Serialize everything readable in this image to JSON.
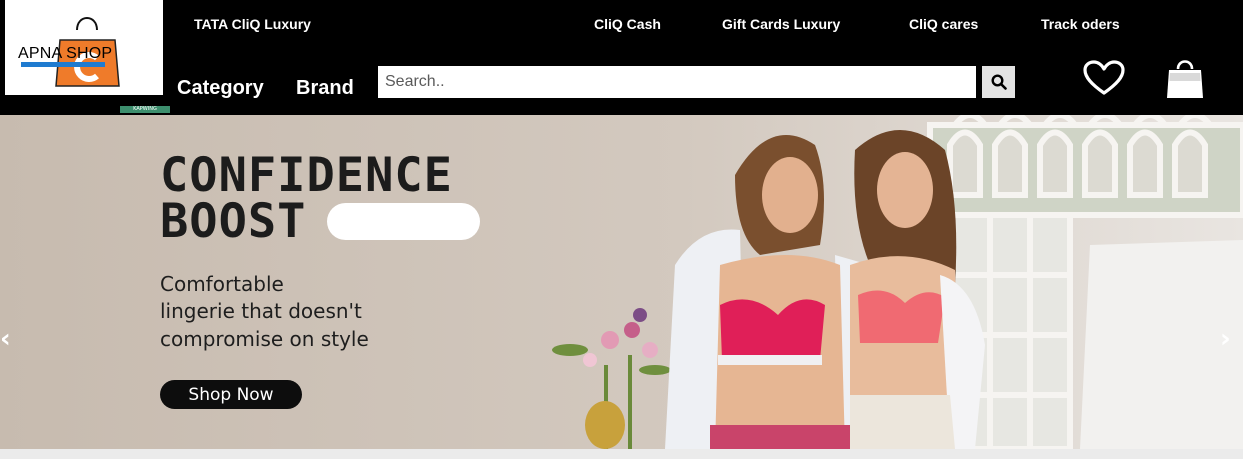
{
  "header": {
    "logo_text": "APNA SHOP",
    "watermark_text": "KAPWING",
    "top_links": [
      "TATA CliQ Luxury",
      "CliQ Cash",
      "Gift Cards Luxury",
      "CliQ cares",
      "Track oders"
    ],
    "main_nav": [
      "Category",
      "Brand"
    ],
    "search": {
      "placeholder": "Search..",
      "value": ""
    },
    "icons": [
      "search-icon",
      "heart-icon",
      "shopping-bag-icon"
    ]
  },
  "banner": {
    "headline_line1": "CONFIDENCE",
    "headline_line2": "BOOST",
    "subtext_lines": [
      "Comfortable",
      "lingerie that doesn't",
      "compromise on style"
    ],
    "cta_label": "Shop Now",
    "prev_arrow": "‹",
    "next_arrow": "›"
  },
  "colors": {
    "header_bg": "#000000",
    "logo_orange": "#ef7b2a",
    "logo_blue": "#1f7bd0",
    "cta_bg": "#0d0d0d",
    "banner_bg": "#cdc2b7"
  }
}
